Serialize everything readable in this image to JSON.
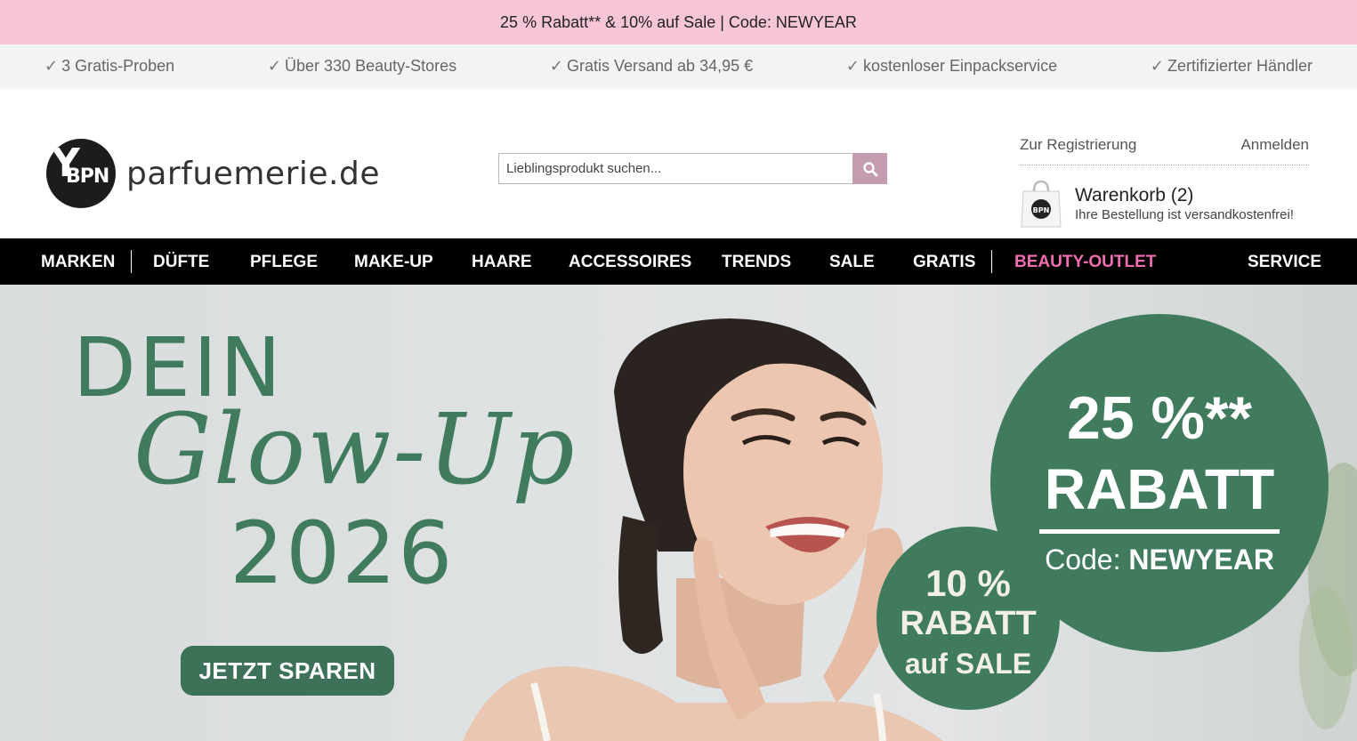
{
  "promo": {
    "text": "25 % Rabatt** & 10% auf Sale | Code: NEWYEAR"
  },
  "usps": [
    {
      "text": "3 Gratis-Proben"
    },
    {
      "text": "Über 330 Beauty-Stores"
    },
    {
      "text": "Gratis Versand ab 34,95 €"
    },
    {
      "text": "kostenloser Einpackservice"
    },
    {
      "text": "Zertifizierter Händler"
    }
  ],
  "header": {
    "logo_mark": "BPN",
    "logo_text": "parfuemerie.de",
    "search_placeholder": "Lieblingsprodukt suchen...",
    "register_link": "Zur Registrierung",
    "login_link": "Anmelden",
    "cart_title": "Warenkorb (2)",
    "cart_subtitle": "Ihre Bestellung ist versandkostenfrei!"
  },
  "nav": {
    "items": [
      "MARKEN",
      "DÜFTE",
      "PFLEGE",
      "MAKE-UP",
      "HAARE",
      "ACCESSOIRES",
      "TRENDS",
      "SALE",
      "GRATIS",
      "BEAUTY-OUTLET",
      "SERVICE"
    ]
  },
  "hero": {
    "headline": "DEIN",
    "script": "Glow-Up",
    "year": "2026",
    "cta": "JETZT SPAREN",
    "badge_big": {
      "percent": "25 %**",
      "label": "RABATT",
      "code_prefix": "Code: ",
      "code": "NEWYEAR"
    },
    "badge_small": {
      "percent": "10 %",
      "label": "RABATT",
      "suffix": "auf SALE"
    }
  },
  "colors": {
    "promo_bg": "#f7c6d6",
    "brand_green": "#3f7b5c",
    "outlet_pink": "#f06eb1",
    "search_btn": "#c49cb0"
  }
}
